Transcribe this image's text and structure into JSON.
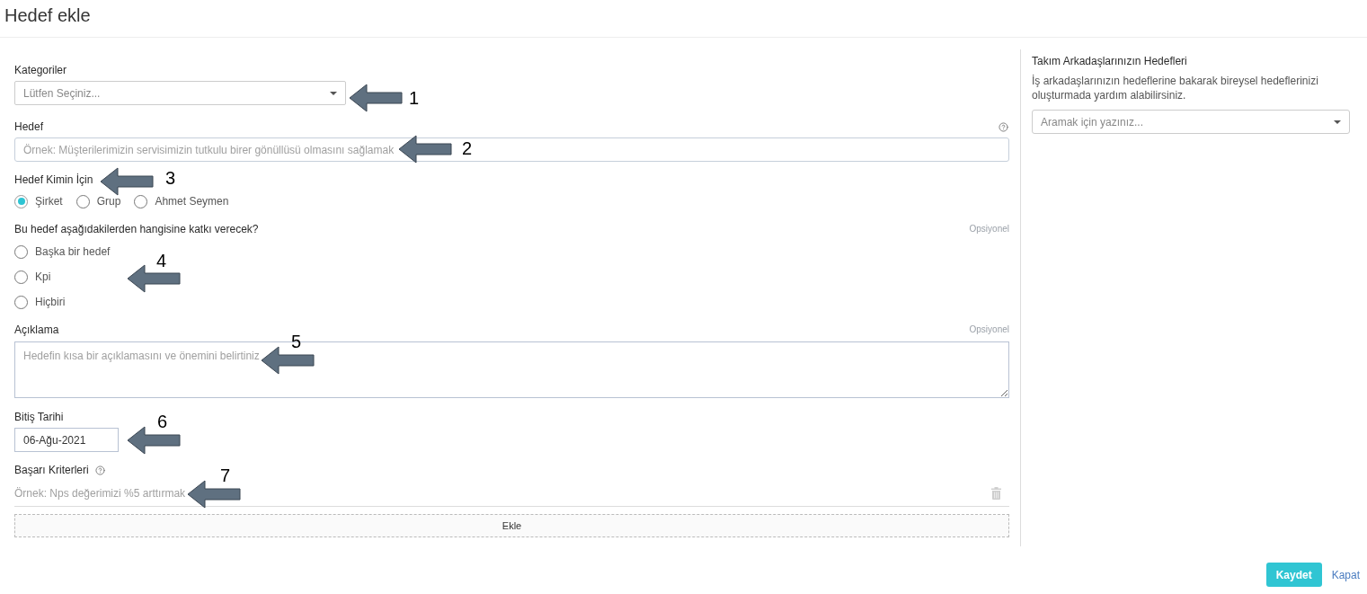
{
  "header": {
    "title": "Hedef ekle"
  },
  "form": {
    "category": {
      "label": "Kategoriler",
      "placeholder": "Lütfen Seçiniz..."
    },
    "goal": {
      "label": "Hedef",
      "placeholder": "Örnek: Müşterilerimizin servisimizin tutkulu birer gönüllüsü olmasını sağlamak"
    },
    "goal_for": {
      "label": "Hedef Kimin İçin",
      "options": [
        {
          "label": "Şirket",
          "selected": true
        },
        {
          "label": "Grup",
          "selected": false
        },
        {
          "label": "Ahmet Seymen",
          "selected": false
        }
      ]
    },
    "contribution": {
      "label": "Bu hedef aşağıdakilerden hangisine katkı verecek?",
      "optional_note": "Opsiyonel",
      "options": [
        {
          "label": "Başka bir hedef",
          "selected": false
        },
        {
          "label": "Kpi",
          "selected": false
        },
        {
          "label": "Hiçbiri",
          "selected": false
        }
      ]
    },
    "description": {
      "label": "Açıklama",
      "optional_note": "Opsiyonel",
      "placeholder": "Hedefin kısa bir açıklamasını ve önemini belirtiniz"
    },
    "end_date": {
      "label": "Bitiş Tarihi",
      "value": "06-Ağu-2021"
    },
    "success_criteria": {
      "label": "Başarı Kriterleri",
      "items": [
        {
          "placeholder": "Örnek: Nps değerimizi %5 arttırmak"
        }
      ],
      "add_button": "Ekle"
    }
  },
  "sidebar": {
    "title": "Takım Arkadaşlarınızın Hedefleri",
    "description": "İş arkadaşlarınızın hedeflerine bakarak bireysel hedeflerinizi oluşturmada yardım alabilirsiniz.",
    "search": {
      "placeholder": "Aramak için yazınız..."
    }
  },
  "footer": {
    "buttons": [
      {
        "label": "Kaydet",
        "kind": "primary"
      },
      {
        "label": "Kapat",
        "kind": "link"
      }
    ]
  },
  "callouts": [
    {
      "number": "1"
    },
    {
      "number": "2"
    },
    {
      "number": "3"
    },
    {
      "number": "4"
    },
    {
      "number": "5"
    },
    {
      "number": "6"
    },
    {
      "number": "7"
    }
  ]
}
